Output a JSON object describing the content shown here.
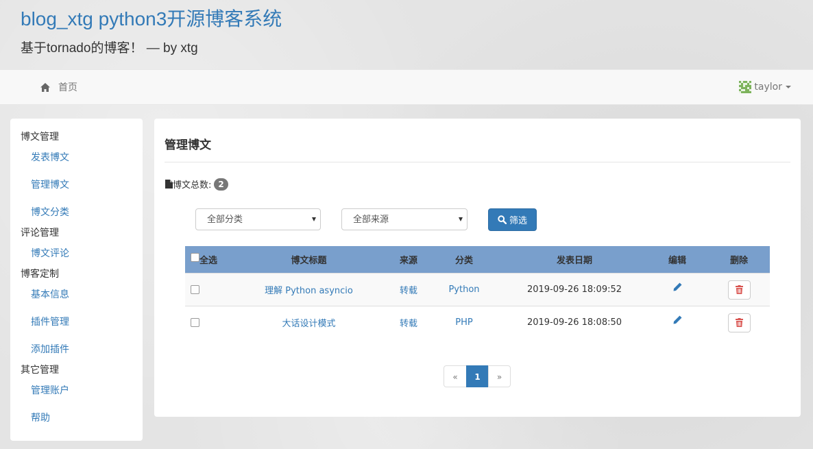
{
  "site": {
    "title": "blog_xtg python3开源博客系统",
    "subtitle": "基于tornado的博客！ — by xtg"
  },
  "nav": {
    "home_label": "首页",
    "user_name": "taylor"
  },
  "sidebar": {
    "groups": [
      {
        "label": "博文管理",
        "items": [
          "发表博文",
          "管理博文",
          "博文分类"
        ]
      },
      {
        "label": "评论管理",
        "items": [
          "博文评论"
        ]
      },
      {
        "label": "博客定制",
        "items": [
          "基本信息",
          "插件管理",
          "添加插件"
        ]
      },
      {
        "label": "其它管理",
        "items": [
          "管理账户",
          "帮助"
        ]
      }
    ]
  },
  "main": {
    "title": "管理博文",
    "count_label": "博文总数:",
    "count": "2",
    "filters": {
      "category_selected": "全部分类",
      "source_selected": "全部来源",
      "filter_button": "筛选"
    },
    "table": {
      "headers": [
        "全选",
        "博文标题",
        "来源",
        "分类",
        "发表日期",
        "编辑",
        "删除"
      ],
      "rows": [
        {
          "title": "理解 Python asyncio",
          "source": "转载",
          "category": "Python",
          "date": "2019-09-26 18:09:52"
        },
        {
          "title": "大话设计模式",
          "source": "转载",
          "category": "PHP",
          "date": "2019-09-26 18:08:50"
        }
      ]
    },
    "pagination": {
      "prev": "«",
      "current": "1",
      "next": "»"
    }
  },
  "colors": {
    "primary": "#337ab7",
    "table_header": "#799fcc",
    "delete_icon": "#d9534f",
    "badge": "#777777"
  }
}
